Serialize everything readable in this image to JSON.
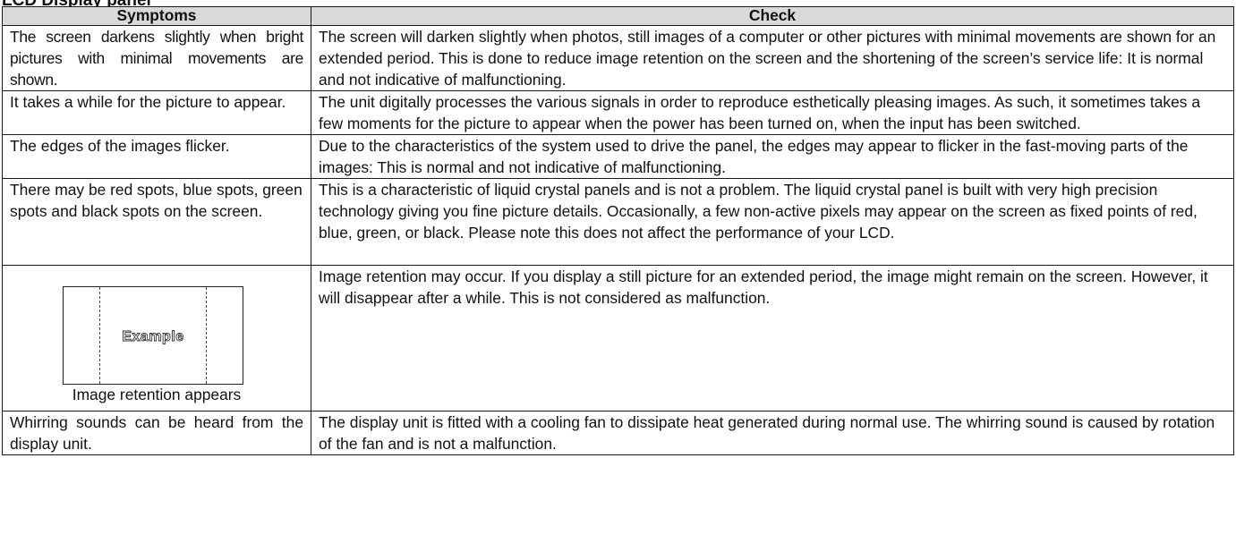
{
  "section_title": "LCD Display panel",
  "table": {
    "headers": {
      "symptoms": "Symptoms",
      "check": "Check"
    },
    "rows": [
      {
        "symptom": "The screen darkens slightly when bright pictures with minimal movements are shown.",
        "check": "The screen will darken slightly when photos, still images of a computer or other pictures with minimal movements are shown for an extended period. This is done to reduce image retention on the screen and the shortening of the screen’s service life: It is normal and not indicative of malfunctioning."
      },
      {
        "symptom": "It takes a while for the picture to appear.",
        "check": "The unit digitally processes the various signals in order to reproduce esthetically pleasing images. As such, it sometimes takes a few moments for the picture to appear when the power has been turned on, when the input has been switched."
      },
      {
        "symptom": "The edges of the images flicker.",
        "check": "Due to the characteristics of the system used to drive the panel, the edges may appear to flicker in the fast-moving parts of the images: This is normal and not indicative of malfunctioning."
      },
      {
        "symptom": "There may be red spots, blue spots, green spots and black spots on the screen.",
        "check": "This is a characteristic of liquid crystal panels and is not a problem. The liquid crystal panel is built with very high precision technology giving you fine picture details. Occasionally, a few non-active pixels may appear on the screen as fixed points of red, blue, green, or black. Please note this does not affect the performance of your LCD."
      },
      {
        "illustration_text": "Example",
        "symptom": "Image retention appears",
        "check": "Image retention may occur. If you display a still picture for an extended period, the image might remain on the screen. However, it will disappear after a while. This is not considered as malfunction."
      },
      {
        "symptom": "Whirring sounds can be heard from the display unit.",
        "check": "The display unit is fitted with a cooling fan to dissipate heat generated during normal use. The whirring sound is caused by rotation of the fan and is not a malfunction."
      }
    ]
  },
  "colors": {
    "header_background": "#d9d9d9",
    "border": "#1a1a1a",
    "text": "#111111"
  }
}
